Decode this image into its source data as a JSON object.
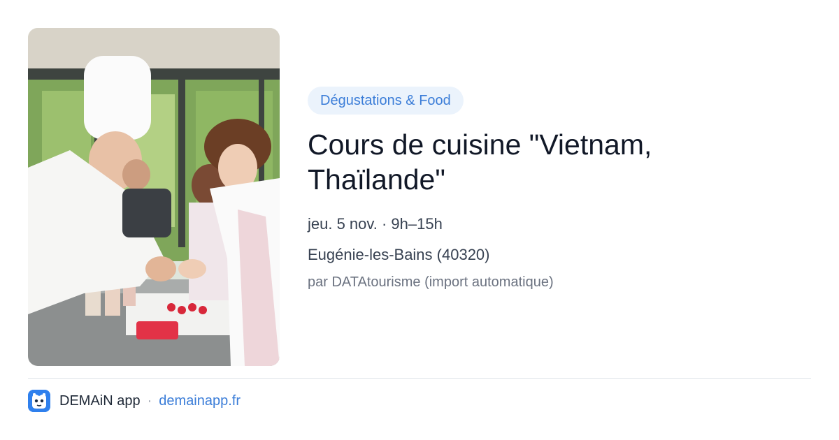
{
  "event": {
    "category": "Dégustations & Food",
    "title": "Cours de cuisine \"Vietnam, Thaïlande\"",
    "datetime": "jeu. 5 nov. · 9h–15h",
    "location": "Eugénie-les-Bains (40320)",
    "source": "par DATAtourisme (import automatique)"
  },
  "footer": {
    "app_name": "DEMAiN app",
    "separator": "·",
    "domain": "demainapp.fr"
  },
  "colors": {
    "accent": "#3b7dd8",
    "badge_bg": "#ebf3fc",
    "logo_bg": "#2f80ed"
  }
}
